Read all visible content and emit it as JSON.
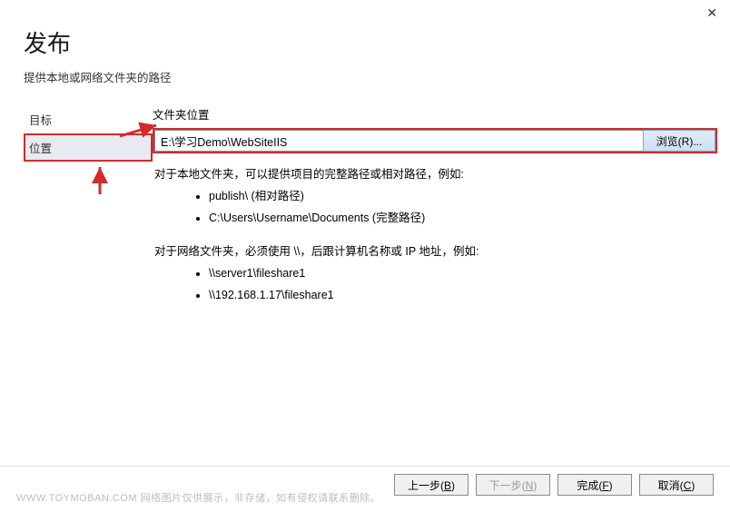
{
  "header": {
    "title": "发布",
    "subtitle": "提供本地或网络文件夹的路径"
  },
  "sidebar": {
    "items": [
      {
        "label": "目标"
      },
      {
        "label": "位置"
      }
    ],
    "active_index": 1
  },
  "content": {
    "folder_label": "文件夹位置",
    "path_value": "E:\\学习Demo\\WebSiteIIS",
    "browse_label": "浏览(R)...",
    "help_local_intro": "对于本地文件夹，可以提供项目的完整路径或相对路径，例如:",
    "help_local_examples": [
      "publish\\ (相对路径)",
      "C:\\Users\\Username\\Documents (完整路径)"
    ],
    "help_network_intro": "对于网络文件夹，必须使用 \\\\，后跟计算机名称或 IP 地址，例如:",
    "help_network_examples": [
      "\\\\server1\\fileshare1",
      "\\\\192.168.1.17\\fileshare1"
    ]
  },
  "footer": {
    "back": {
      "text": "上一步(",
      "hotkey": "B",
      "suffix": ")"
    },
    "next": {
      "text": "下一步(",
      "hotkey": "N",
      "suffix": ")"
    },
    "finish": {
      "text": "完成(",
      "hotkey": "F",
      "suffix": ")"
    },
    "cancel": {
      "text": "取消(",
      "hotkey": "C",
      "suffix": ")"
    }
  },
  "watermark": "WWW.TOYMOBAN.COM  网络图片仅供展示，非存储，如有侵权请联系删除。",
  "annotations": {
    "arrow_color": "#d22b2b"
  }
}
